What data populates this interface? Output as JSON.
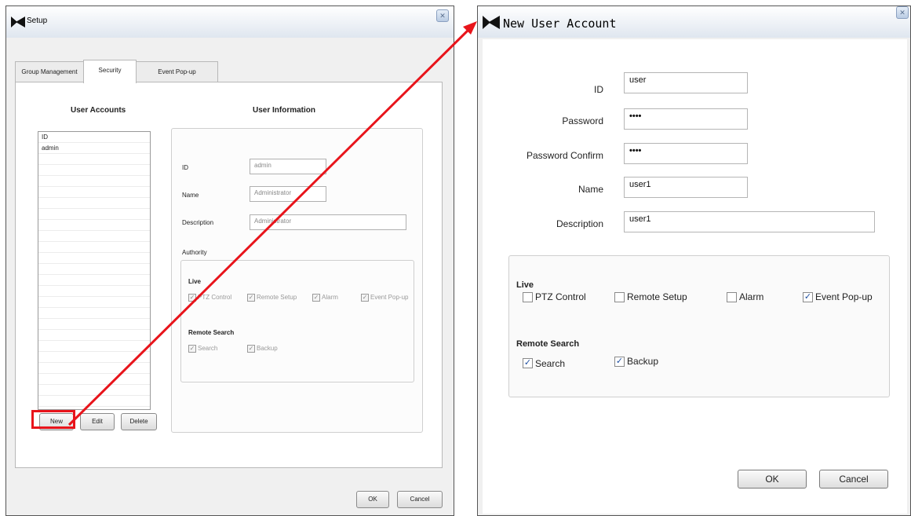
{
  "setup_window": {
    "title": "Setup",
    "tabs": [
      {
        "label": "Group Management",
        "active": false
      },
      {
        "label": "Security",
        "active": true
      },
      {
        "label": "Event Pop-up",
        "active": false
      }
    ],
    "user_accounts_header": "User Accounts",
    "user_information_header": "User Information",
    "accounts_list": {
      "column_header": "ID",
      "rows": [
        "admin"
      ]
    },
    "fields": {
      "id_label": "ID",
      "id_value": "admin",
      "name_label": "Name",
      "name_value": "Administrator",
      "description_label": "Description",
      "description_value": "Administrator"
    },
    "authority": {
      "label": "Authority",
      "live_label": "Live",
      "live_options": [
        {
          "label": "PTZ Control",
          "checked": true
        },
        {
          "label": "Remote Setup",
          "checked": true
        },
        {
          "label": "Alarm",
          "checked": true
        },
        {
          "label": "Event Pop-up",
          "checked": true
        }
      ],
      "remote_search_label": "Remote Search",
      "remote_search_options": [
        {
          "label": "Search",
          "checked": true
        },
        {
          "label": "Backup",
          "checked": true
        }
      ]
    },
    "buttons": {
      "new": "New",
      "edit": "Edit",
      "delete": "Delete",
      "ok": "OK",
      "cancel": "Cancel"
    }
  },
  "new_user_dialog": {
    "title": "New User Account",
    "fields": {
      "id_label": "ID",
      "id_value": "user",
      "password_label": "Password",
      "password_value": "••••",
      "password_confirm_label": "Password Confirm",
      "password_confirm_value": "••••",
      "name_label": "Name",
      "name_value": "user1",
      "description_label": "Description",
      "description_value": "user1"
    },
    "live_label": "Live",
    "live_options": [
      {
        "label": "PTZ Control",
        "checked": false
      },
      {
        "label": "Remote Setup",
        "checked": false
      },
      {
        "label": "Alarm",
        "checked": false
      },
      {
        "label": "Event Pop-up",
        "checked": true
      }
    ],
    "remote_search_label": "Remote Search",
    "remote_search_options": [
      {
        "label": "Search",
        "checked": true
      },
      {
        "label": "Backup",
        "checked": true
      }
    ],
    "buttons": {
      "ok": "OK",
      "cancel": "Cancel"
    }
  },
  "colors": {
    "highlight": "#e8141b",
    "arrow": "#e8141b"
  },
  "icons": {
    "app_logo": "arrow-logo-icon",
    "close": "close-icon"
  }
}
